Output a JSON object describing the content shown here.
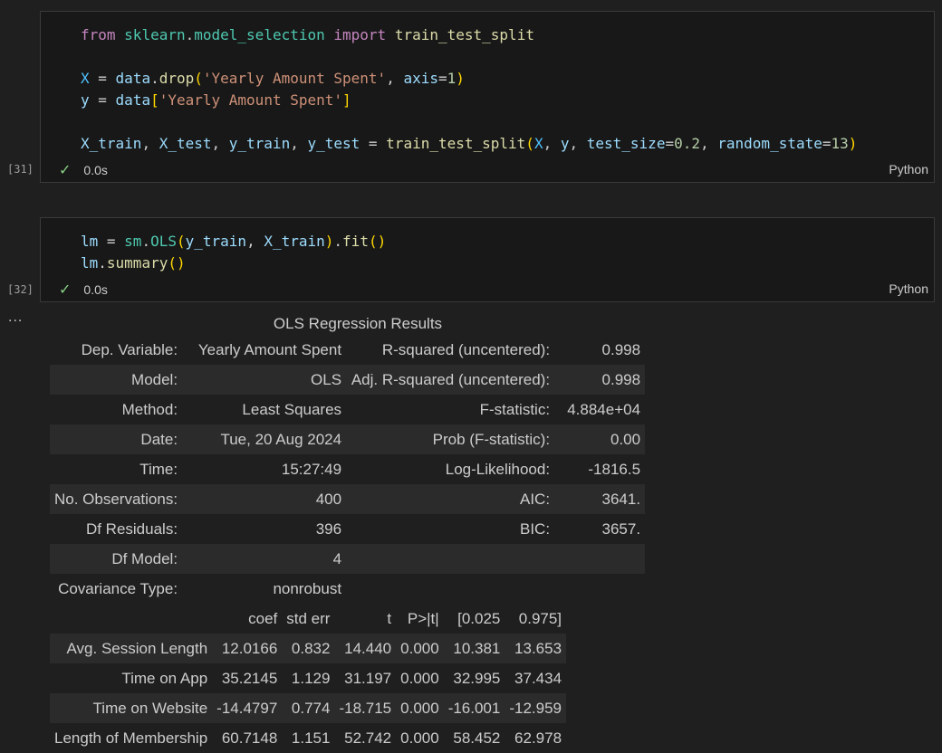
{
  "cells": [
    {
      "exec_count": "[31]",
      "status_time": "0.0s",
      "language": "Python",
      "code_lines": [
        "from sklearn.model_selection import train_test_split",
        "",
        "X = data.drop('Yearly Amount Spent', axis=1)",
        "y = data['Yearly Amount Spent']",
        "",
        "X_train, X_test, y_train, y_test = train_test_split(X, y, test_size=0.2, random_state=13)"
      ]
    },
    {
      "exec_count": "[32]",
      "status_time": "0.0s",
      "language": "Python",
      "code_lines": [
        "lm = sm.OLS(y_train, X_train).fit()",
        "lm.summary()"
      ]
    }
  ],
  "output": {
    "ellipsis": "...",
    "title": "OLS Regression Results",
    "summary_rows": [
      [
        "Dep. Variable:",
        "Yearly Amount Spent",
        "R-squared (uncentered):",
        "0.998"
      ],
      [
        "Model:",
        "OLS",
        "Adj. R-squared (uncentered):",
        "0.998"
      ],
      [
        "Method:",
        "Least Squares",
        "F-statistic:",
        "4.884e+04"
      ],
      [
        "Date:",
        "Tue, 20 Aug 2024",
        "Prob (F-statistic):",
        "0.00"
      ],
      [
        "Time:",
        "15:27:49",
        "Log-Likelihood:",
        "-1816.5"
      ],
      [
        "No. Observations:",
        "400",
        "AIC:",
        "3641."
      ],
      [
        "Df Residuals:",
        "396",
        "BIC:",
        "3657."
      ],
      [
        "Df Model:",
        "4",
        "",
        ""
      ],
      [
        "Covariance Type:",
        "nonrobust",
        "",
        ""
      ]
    ],
    "coef_headers": [
      "",
      "coef",
      "std err",
      "t",
      "P>|t|",
      "[0.025",
      "0.975]"
    ],
    "coef_rows": [
      [
        "Avg. Session Length",
        "12.0166",
        "0.832",
        "14.440",
        "0.000",
        "10.381",
        "13.653"
      ],
      [
        "Time on App",
        "35.2145",
        "1.129",
        "31.197",
        "0.000",
        "32.995",
        "37.434"
      ],
      [
        "Time on Website",
        "-14.4797",
        "0.774",
        "-18.715",
        "0.000",
        "-16.001",
        "-12.959"
      ],
      [
        "Length of Membership",
        "60.7148",
        "1.151",
        "52.742",
        "0.000",
        "58.452",
        "62.978"
      ]
    ]
  },
  "colors": {
    "background": "#1f1f1f",
    "cell_background": "#181818",
    "keyword": "#c586c0",
    "function": "#dcdcaa",
    "variable": "#9cdcfe",
    "string": "#ce9178",
    "number": "#b5cea8",
    "success_check": "#89d185"
  }
}
